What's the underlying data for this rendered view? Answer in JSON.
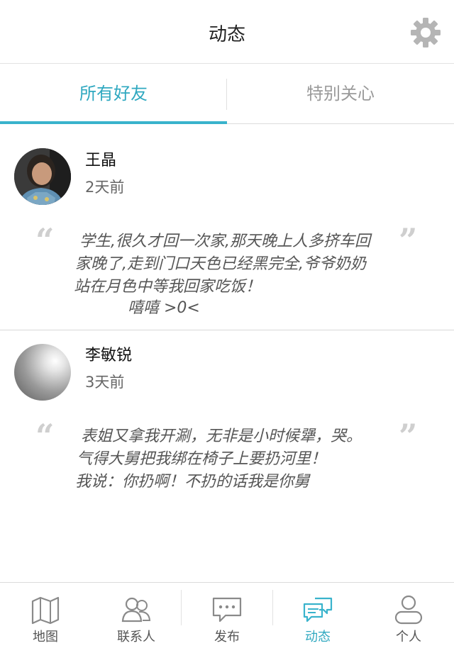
{
  "header": {
    "title": "动态",
    "settings_icon": "gear-icon"
  },
  "tabs": [
    {
      "label": "所有好友",
      "active": true
    },
    {
      "label": "特别关心",
      "active": false
    }
  ],
  "colors": {
    "accent": "#39b3cc",
    "accent_text": "#2fa8c0",
    "inactive_text": "#9a9a9a"
  },
  "posts": [
    {
      "name": "王晶",
      "time": "2天前",
      "content_lines": [
        "学生,很久才回一次家,那天晚上人多挤车回",
        "家晚了,走到门口天色已经黑完全,爷爷奶奶",
        "站在月色中等我回家吃饭！",
        "嘻嘻 >0<"
      ]
    },
    {
      "name": "李敏锐",
      "time": "3天前",
      "content_lines": [
        "表姐又拿我开涮，无非是小时候犟，哭。",
        "气得大舅把我绑在椅子上要扔河里！",
        "我说：你扔啊！不扔的话我是你舅"
      ]
    }
  ],
  "quote": {
    "open": "“",
    "close": "”"
  },
  "bottom_nav": [
    {
      "label": "地图",
      "icon": "map-icon",
      "active": false
    },
    {
      "label": "联系人",
      "icon": "contacts-icon",
      "active": false
    },
    {
      "label": "发布",
      "icon": "message-icon",
      "active": false
    },
    {
      "label": "动态",
      "icon": "chat-bubbles-icon",
      "active": true
    },
    {
      "label": "个人",
      "icon": "person-icon",
      "active": false
    }
  ]
}
